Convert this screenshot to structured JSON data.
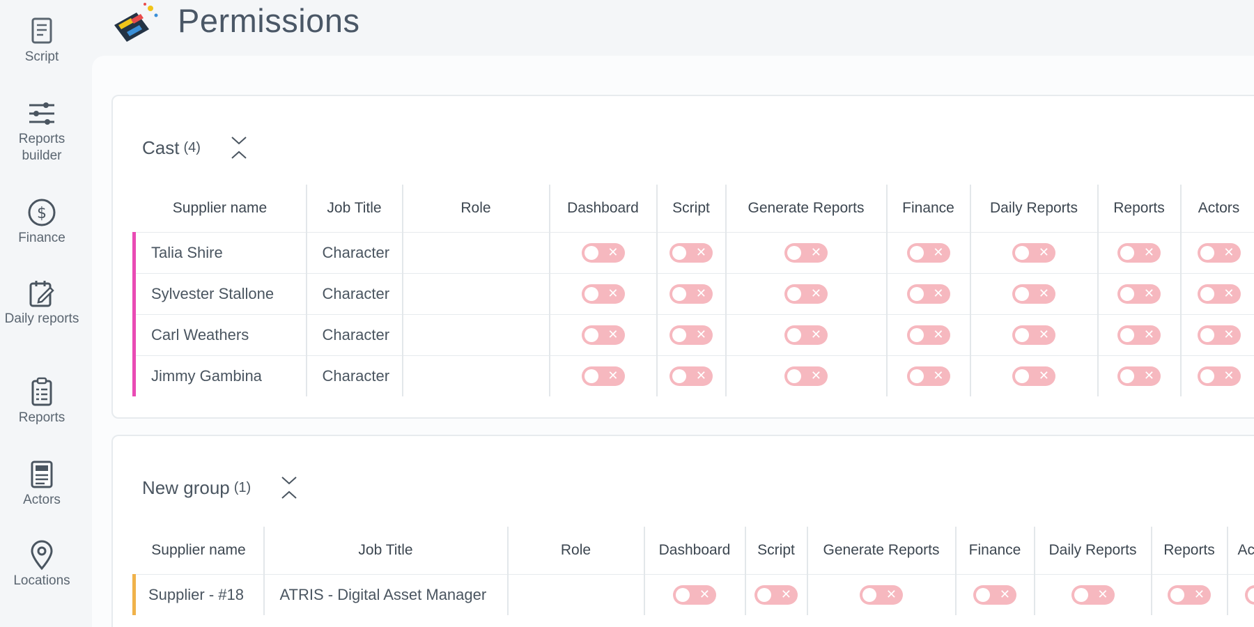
{
  "page": {
    "title": "Permissions"
  },
  "sidebar": {
    "items": [
      {
        "label": "Script",
        "icon": "script-icon"
      },
      {
        "label": "Reports builder",
        "icon": "sliders-icon"
      },
      {
        "label": "Finance",
        "icon": "dollar-icon"
      },
      {
        "label": "Daily reports",
        "icon": "daily-reports-icon"
      },
      {
        "label": "Reports",
        "icon": "clipboard-icon"
      },
      {
        "label": "Actors",
        "icon": "actors-icon"
      },
      {
        "label": "Locations",
        "icon": "location-pin-icon"
      }
    ]
  },
  "groups": [
    {
      "name": "Cast",
      "count": "(4)",
      "accent": "#e94bb4",
      "columns": [
        "Supplier name",
        "Job Title",
        "Role",
        "Dashboard",
        "Script",
        "Generate Reports",
        "Finance",
        "Daily Reports",
        "Reports",
        "Actors"
      ],
      "rows": [
        {
          "supplier": "Talia Shire",
          "job_title": "Character",
          "role": ""
        },
        {
          "supplier": "Sylvester Stallone",
          "job_title": "Character",
          "role": ""
        },
        {
          "supplier": "Carl Weathers",
          "job_title": "Character",
          "role": ""
        },
        {
          "supplier": "Jimmy Gambina",
          "job_title": "Character",
          "role": ""
        }
      ]
    },
    {
      "name": "New group",
      "count": "(1)",
      "accent": "#f0b24a",
      "columns": [
        "Supplier name",
        "Job Title",
        "Role",
        "Dashboard",
        "Script",
        "Generate Reports",
        "Finance",
        "Daily Reports",
        "Reports",
        "Ac"
      ],
      "rows": [
        {
          "supplier": "Supplier - #18",
          "job_title": "ATRIS - Digital Asset Manager",
          "role": ""
        }
      ]
    }
  ],
  "toggle_state": "off",
  "colors": {
    "toggle_off": "#f6b8bf",
    "cast_accent": "#e94bb4",
    "new_group_accent": "#f0b24a"
  }
}
